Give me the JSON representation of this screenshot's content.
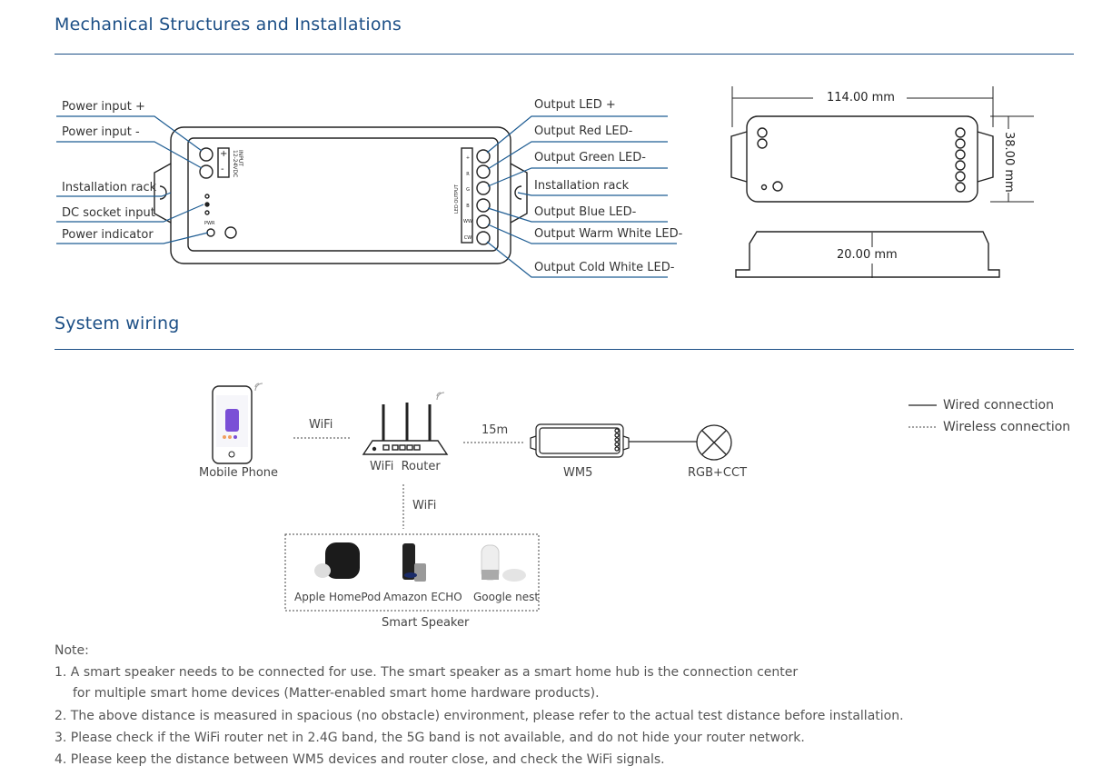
{
  "sections": {
    "mechanical_title": "Mechanical Structures and Installations",
    "wiring_title": "System wiring"
  },
  "device_labels_left": [
    "Power input +",
    "Power input -",
    "Installation rack",
    "DC socket input",
    "Power indicator"
  ],
  "device_labels_right": [
    "Output LED +",
    "Output Red LED-",
    "Output Green LED-",
    "Installation rack",
    "Output Blue LED-",
    "Output Warm White LED-",
    "Output Cold White LED-"
  ],
  "device_markings": {
    "input": "INPUT",
    "voltage": "12-24VDC",
    "plus": "+",
    "minus": "-",
    "pwr": "PWR",
    "led_output": "LED OUTPUT",
    "terminals": [
      "+",
      "R",
      "G",
      "B",
      "WW",
      "CW"
    ]
  },
  "dimensions": {
    "length": "114.00 mm",
    "width": "38.00 mm",
    "height": "20.00 mm"
  },
  "wiring": {
    "mobile_phone": "Mobile Phone",
    "wifi_label_1": "WiFi",
    "router": "WiFi  Router",
    "distance": "15m",
    "controller": "WM5",
    "load": "RGB+CCT",
    "wifi_label_2": "WiFi",
    "speakers": [
      "Apple HomePod",
      "Amazon ECHO",
      "Google nest"
    ],
    "speaker_group": "Smart Speaker"
  },
  "legend": {
    "wired": "Wired connection",
    "wireless": "Wireless connection"
  },
  "notes": {
    "heading": "Note:",
    "items": [
      "1. A smart speaker needs to be connected for use. The smart speaker as a smart home hub is the connection center",
      "    for multiple smart home devices (Matter-enabled smart home hardware products).",
      "2. The above distance is measured in spacious (no obstacle) environment, please refer to the actual test distance before installation.",
      "3. Please check if the WiFi router net in 2.4G band, the 5G band is not available, and do not hide your router network.",
      "4. Please keep the distance between WM5 devices and router close, and check the WiFi signals."
    ]
  },
  "colors": {
    "accent": "#1c4f86",
    "phone_screen": "#7a4fd6"
  }
}
